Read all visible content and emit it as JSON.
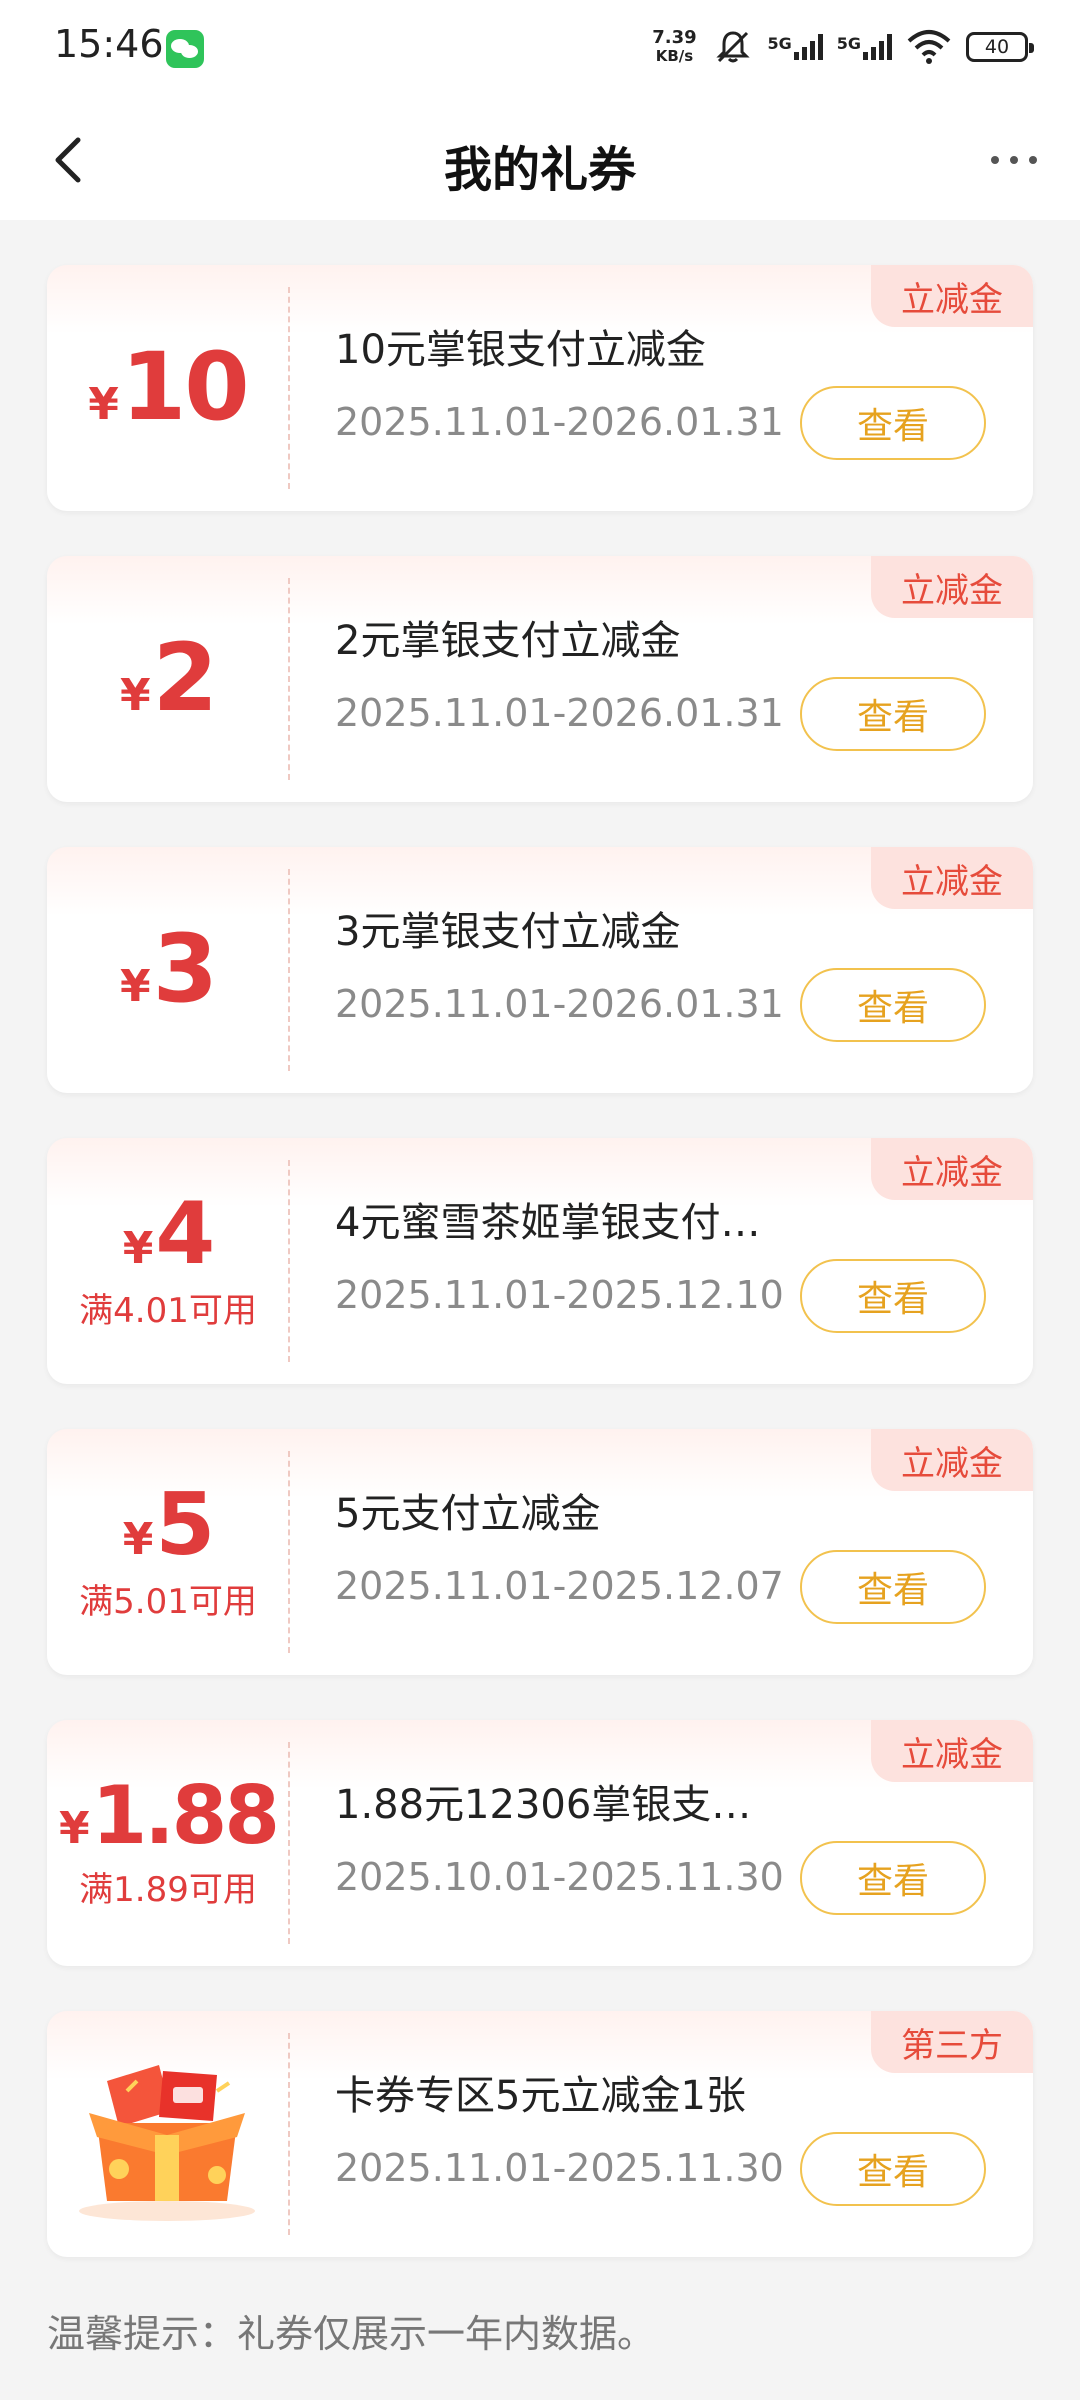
{
  "status_bar": {
    "time": "15:46",
    "net_speed_value": "7.39",
    "net_speed_unit": "KB/s",
    "signal1_label": "5G",
    "signal2_label": "5G",
    "battery": "40"
  },
  "header": {
    "title": "我的礼券"
  },
  "coupons": [
    {
      "symbol": "¥",
      "amount": "10",
      "condition": "",
      "title": "10元掌银支付立减金",
      "date": "2025.11.01-2026.01.31",
      "tag": "立减金",
      "button": "查看"
    },
    {
      "symbol": "¥",
      "amount": "2",
      "condition": "",
      "title": "2元掌银支付立减金",
      "date": "2025.11.01-2026.01.31",
      "tag": "立减金",
      "button": "查看"
    },
    {
      "symbol": "¥",
      "amount": "3",
      "condition": "",
      "title": "3元掌银支付立减金",
      "date": "2025.11.01-2026.01.31",
      "tag": "立减金",
      "button": "查看"
    },
    {
      "symbol": "¥",
      "amount": "4",
      "condition": "满4.01可用",
      "title": "4元蜜雪茶姬掌银支付…",
      "date": "2025.11.01-2025.12.10",
      "tag": "立减金",
      "button": "查看"
    },
    {
      "symbol": "¥",
      "amount": "5",
      "condition": "满5.01可用",
      "title": "5元支付立减金",
      "date": "2025.11.01-2025.12.07",
      "tag": "立减金",
      "button": "查看"
    },
    {
      "symbol": "¥",
      "amount": "1.88",
      "condition": "满1.89可用",
      "title": "1.88元12306掌银支…",
      "date": "2025.10.01-2025.11.30",
      "tag": "立减金",
      "button": "查看"
    },
    {
      "title": "卡券专区5元立减金1张",
      "date": "2025.11.01-2025.11.30",
      "tag": "第三方",
      "button": "查看",
      "image": "gift-box-image"
    }
  ],
  "footer": {
    "tip": "温馨提示：礼券仅展示一年内数据。"
  },
  "colors": {
    "accent_red": "#e03c3c",
    "button_orange": "#e6a21f",
    "button_border": "#f2c24e",
    "tag_bg": "#fde2de"
  }
}
